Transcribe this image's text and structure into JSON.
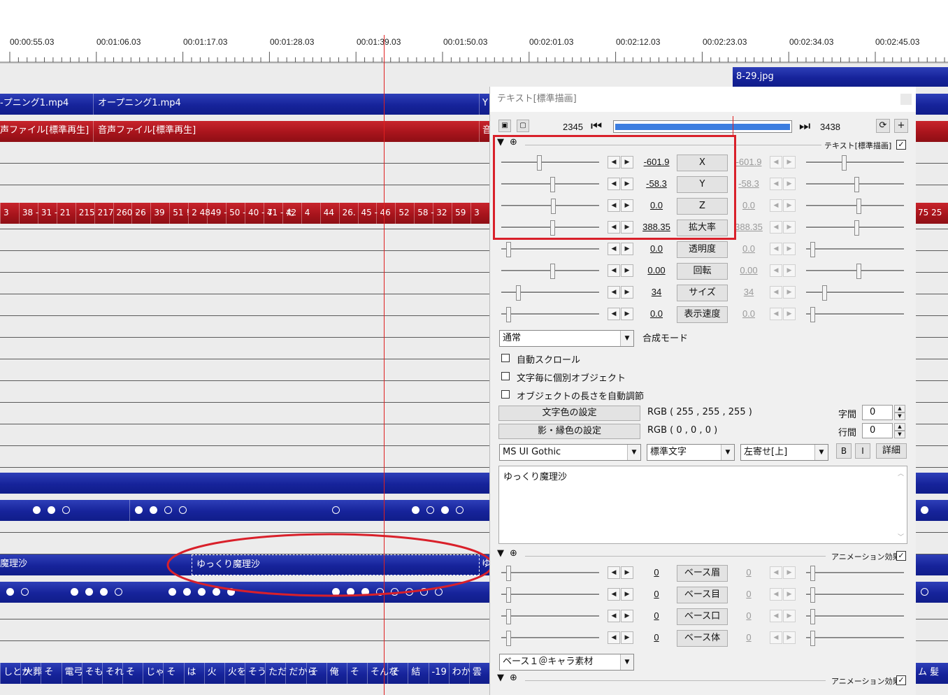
{
  "ruler": {
    "times": [
      "00:00:55.03",
      "00:01:06.03",
      "00:01:17.03",
      "00:01:28.03",
      "00:01:39.03",
      "00:01:50.03",
      "00:02:01.03",
      "00:02:12.03",
      "00:02:23.03",
      "00:02:34.03",
      "00:02:45.03"
    ]
  },
  "timeline": {
    "image_clip": "8-29.jpg",
    "video_clip_1": "-プニング1.mp4",
    "video_clip_2": "オープニング1.mp4",
    "video_clip_edge": "Y",
    "audio_clip_1": "声ファイル[標準再生]",
    "audio_clip_2": "音声ファイル[標準再生]",
    "audio_clip_edge": "音",
    "subtitle_segments": [
      "3",
      "38 -",
      "31 -",
      "21",
      "215",
      "217",
      "260 -",
      "26",
      "39",
      "51 !",
      "2 48",
      "49 -",
      "50 -",
      "40 - 7",
      "41 - た",
      "42",
      "4",
      "44",
      "26.",
      "45 -",
      "46",
      "52",
      "58 -",
      "32",
      "59",
      "3"
    ],
    "subtitle_right": "75 25",
    "text_clip_left": "魔理沙",
    "text_clip_selected": "ゆっくり魔理沙",
    "text_clip_edge": "ゆ",
    "bottom_segments": [
      "しとか",
      "火葬",
      "そ",
      "電弓",
      "そも",
      "それ",
      "そ",
      "じゃ",
      "そ",
      "は",
      "火",
      "火を",
      "そう",
      "ただ",
      "だから",
      "そ",
      "俺",
      "そ",
      "そんな",
      "そ",
      "結",
      "-19",
      "わか",
      "雲"
    ],
    "bottom_right": "ム 髪"
  },
  "panel": {
    "title": "テキスト[標準描画]",
    "frame_start": "2345",
    "frame_end": "3438",
    "section1_label": "テキスト[標準描画]",
    "rows": [
      {
        "left": "-601.9",
        "button": "X",
        "right": "-601.9"
      },
      {
        "left": "-58.3",
        "button": "Y",
        "right": "-58.3"
      },
      {
        "left": "0.0",
        "button": "Z",
        "right": "0.0"
      },
      {
        "left": "388.35",
        "button": "拡大率",
        "right": "388.35"
      },
      {
        "left": "0.0",
        "button": "透明度",
        "right": "0.0"
      },
      {
        "left": "0.00",
        "button": "回転",
        "right": "0.00"
      },
      {
        "left": "34",
        "button": "サイズ",
        "right": "34"
      },
      {
        "left": "0.0",
        "button": "表示速度",
        "right": "0.0"
      }
    ],
    "blend_value": "通常",
    "blend_label": "合成モード",
    "checkboxes": [
      "自動スクロール",
      "文字毎に個別オブジェクト",
      "オブジェクトの長さを自動調節"
    ],
    "text_color_btn": "文字色の設定",
    "text_color_val": "RGB ( 255 , 255 , 255 )",
    "shadow_color_btn": "影・縁色の設定",
    "shadow_color_val": "RGB ( 0 , 0 , 0 )",
    "char_spacing_label": "字間",
    "char_spacing_val": "0",
    "line_spacing_label": "行間",
    "line_spacing_val": "0",
    "font": "MS UI Gothic",
    "style": "標準文字",
    "align": "左寄せ[上]",
    "bold": "B",
    "italic": "I",
    "detail": "詳細",
    "text_content": "ゆっくり魔理沙",
    "anim_label": "アニメーション効果",
    "anim_rows": [
      {
        "left": "0",
        "button": "ベース眉",
        "right": "0"
      },
      {
        "left": "0",
        "button": "ベース目",
        "right": "0"
      },
      {
        "left": "0",
        "button": "ベース口",
        "right": "0"
      },
      {
        "left": "0",
        "button": "ベース体",
        "right": "0"
      }
    ],
    "anim_select": "ベース１＠キャラ素材",
    "anim_label_2": "アニメーション効果"
  },
  "colors": {
    "clip_blue": "#16239a",
    "clip_red": "#a8141c",
    "annotation_red": "#d9202a",
    "slider_bar_blue": "#3d7ee0"
  }
}
